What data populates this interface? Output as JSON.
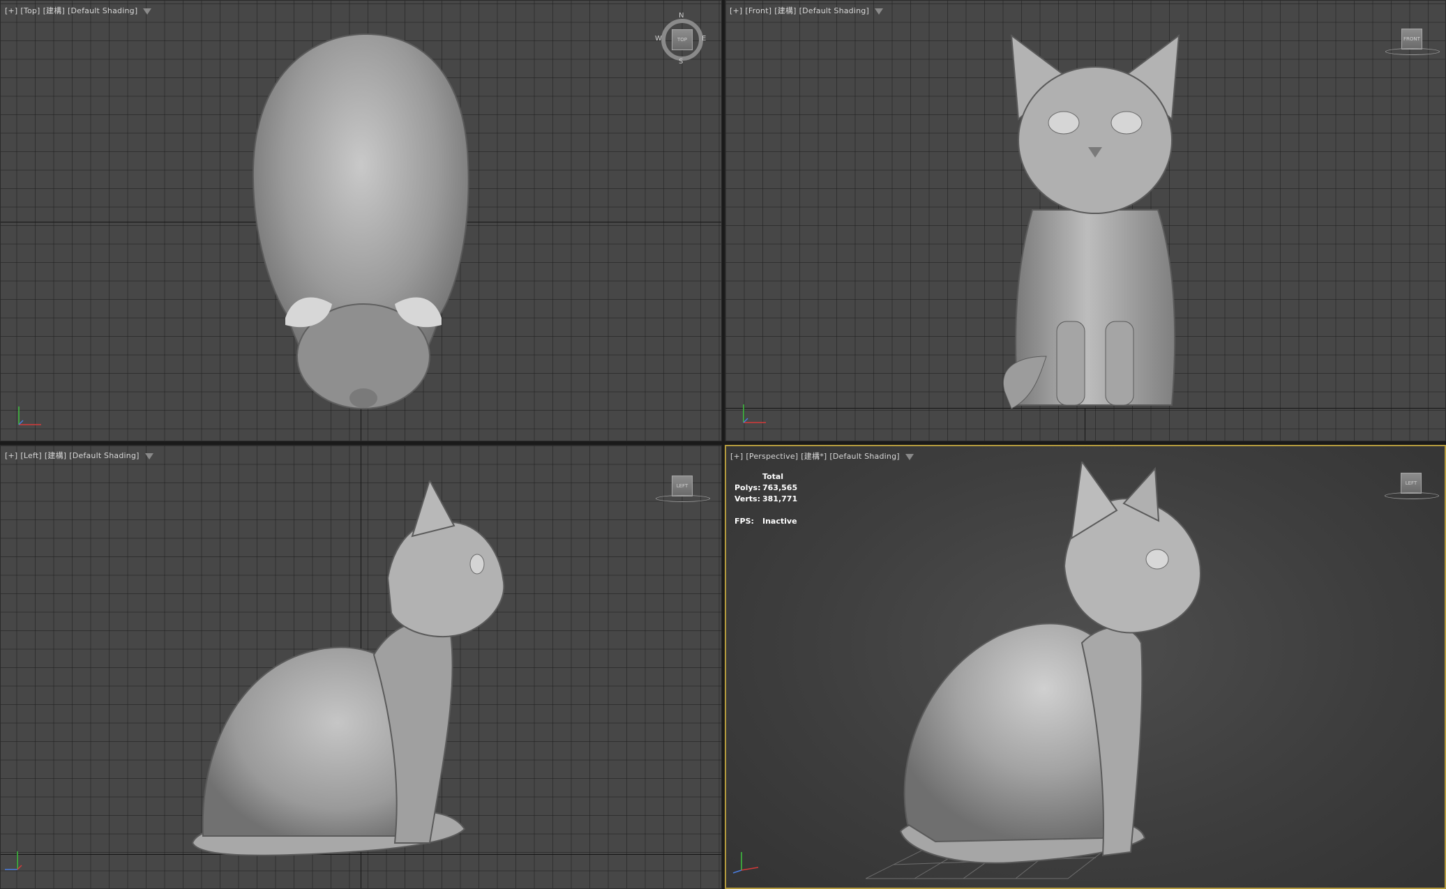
{
  "viewports": {
    "top": {
      "plus": "[+]",
      "view": "[Top]",
      "mode": "[建構]",
      "shading": "[Default Shading]"
    },
    "front": {
      "plus": "[+]",
      "view": "[Front]",
      "mode": "[建構]",
      "shading": "[Default Shading]"
    },
    "left": {
      "plus": "[+]",
      "view": "[Left]",
      "mode": "[建構]",
      "shading": "[Default Shading]"
    },
    "perspective": {
      "plus": "[+]",
      "view": "[Perspective]",
      "mode": "[建構*]",
      "shading": "[Default Shading]"
    }
  },
  "compass": {
    "n": "N",
    "s": "S",
    "e": "E",
    "w": "W",
    "cube": "TOP"
  },
  "viewcubes": {
    "front": "FRONT",
    "left": "LEFT",
    "perspective": "LEFT"
  },
  "stats": {
    "header": "Total",
    "polys_label": "Polys:",
    "polys_value": "763,565",
    "verts_label": "Verts:",
    "verts_value": "381,771",
    "fps_label": "FPS:",
    "fps_value": "Inactive"
  },
  "colors": {
    "active_border": "#b49b3e",
    "viewport_bg": "#474747",
    "model_gray": "#9a9a9a"
  }
}
